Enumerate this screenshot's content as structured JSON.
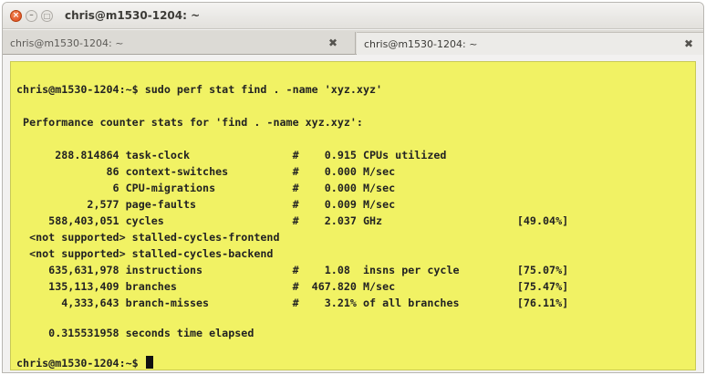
{
  "window": {
    "title": "chris@m1530-1204: ~",
    "buttons": {
      "close": "×",
      "minimize": "–",
      "maximize": "□"
    }
  },
  "tabs": [
    {
      "label": "chris@m1530-1204: ~",
      "close": "✖",
      "active": false
    },
    {
      "label": "chris@m1530-1204: ~",
      "close": "✖",
      "active": true
    }
  ],
  "terminal": {
    "background": "#f1f264",
    "lines": [
      "chris@m1530-1204:~$ sudo perf stat find . -name 'xyz.xyz'",
      " Performance counter stats for 'find . -name xyz.xyz':",
      "      288.814864 task-clock                #    0.915 CPUs utilized",
      "              86 context-switches          #    0.000 M/sec",
      "               6 CPU-migrations            #    0.000 M/sec",
      "           2,577 page-faults               #    0.009 M/sec",
      "     588,403,051 cycles                    #    2.037 GHz                     [49.04%]",
      "  <not supported> stalled-cycles-frontend",
      "  <not supported> stalled-cycles-backend",
      "     635,631,978 instructions              #    1.08  insns per cycle         [75.07%]",
      "     135,113,409 branches                  #  467.820 M/sec                   [75.47%]",
      "       4,333,643 branch-misses             #    3.21% of all branches         [76.11%]",
      "     0.315531958 seconds time elapsed",
      "chris@m1530-1204:~$ "
    ]
  }
}
